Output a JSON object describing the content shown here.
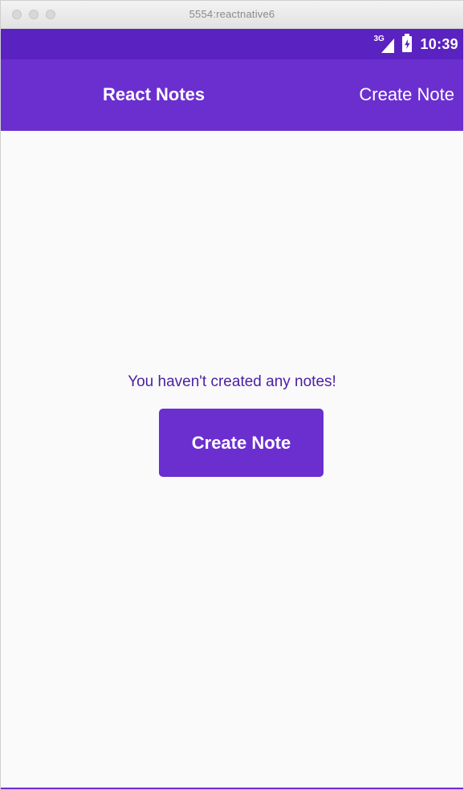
{
  "window": {
    "title": "5554:reactnative6"
  },
  "statusbar": {
    "network": "3G",
    "time": "10:39"
  },
  "appbar": {
    "title": "React Notes",
    "action_label": "Create Note"
  },
  "main": {
    "empty_message": "You haven't created any notes!",
    "create_button_label": "Create Note"
  },
  "colors": {
    "statusbar": "#5a22c0",
    "appbar": "#6b2fd0",
    "accent_text": "#4b1fa3",
    "background": "#fafafa"
  }
}
